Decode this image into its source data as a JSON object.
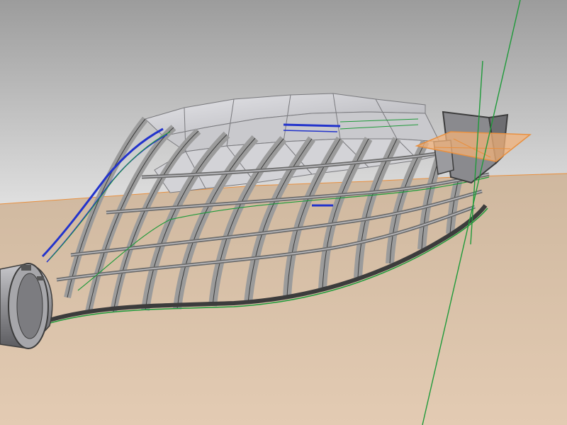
{
  "viewport": {
    "description_free": true,
    "colors": {
      "sky_top": "#9c9c9c",
      "sky_bottom": "#e2e2e2",
      "ground_near": "#e3cbb3",
      "ground_far": "#cfb89f",
      "frame_fill": "#9b9b9b",
      "frame_dark": "#6c6c6c",
      "frame_edge": "#3c3c3c",
      "skin_light": "#d9d9dc",
      "skin_mid": "#c0c0c4",
      "skin_dark": "#a7a7ac",
      "axis_green": "#1f9a3a",
      "selection_blue": "#2233cc",
      "plane_orange": "#e89040",
      "plane_fill": "#f2b27a"
    },
    "objects": [
      {
        "name": "ship-hull-frame-model"
      },
      {
        "name": "construction-plane"
      },
      {
        "name": "reference-axis-line"
      }
    ]
  }
}
